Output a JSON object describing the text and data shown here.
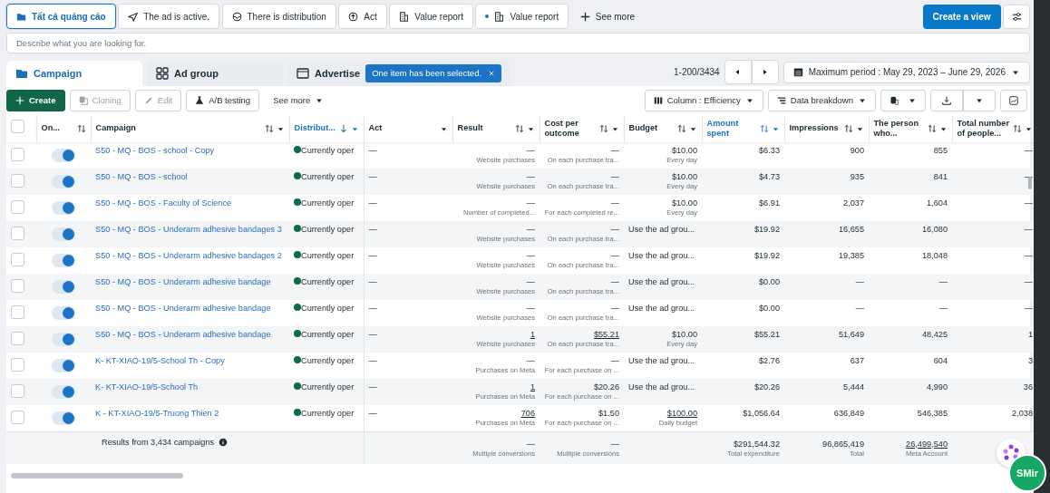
{
  "filters": [
    {
      "label": "Tất cả quảng cáo",
      "selected": true
    },
    {
      "label": "The ad is active.",
      "selected": false
    },
    {
      "label": "There is distribution",
      "selected": false
    },
    {
      "label": "Act",
      "selected": false
    },
    {
      "label": "Value report",
      "selected": false
    },
    {
      "label": "Value report",
      "selected": false,
      "dot": true
    }
  ],
  "filters_more": "See more",
  "create_view": "Create a view",
  "search": {
    "placeholder": "Describe what you are looking for."
  },
  "level_tabs": [
    {
      "label": "Campaign",
      "selected": true
    },
    {
      "label": "Ad group",
      "selected": false
    },
    {
      "label": "Advertise",
      "selected": false
    }
  ],
  "selection_badge": "One item has been selected.",
  "pagination": "1-200/3434",
  "date_range": "Maximum period : May 29, 2023 – June 29, 2026",
  "toolbar": [
    {
      "label": "Create",
      "kind": "primary",
      "disabled": false
    },
    {
      "label": "Cloning",
      "kind": "copy",
      "disabled": true
    },
    {
      "label": "Edit",
      "kind": "edit",
      "disabled": true
    },
    {
      "label": "A/B testing",
      "kind": "flask",
      "disabled": false
    },
    {
      "label": "See more",
      "kind": "menu",
      "disabled": false
    }
  ],
  "view_controls": [
    {
      "label": "Column : Efficiency"
    },
    {
      "label": "Data breakdown"
    }
  ],
  "table": {
    "select_all": {
      "checked": false
    },
    "columns": [
      {
        "label": "On...",
        "sortable": true,
        "menu": false,
        "highlighted": false
      },
      {
        "label": "Campaign",
        "sortable": true,
        "menu": true,
        "highlighted": false
      },
      {
        "label": "Distribut...",
        "sortable": false,
        "sorted_down": true,
        "menu": true,
        "highlighted": true
      },
      {
        "label": "Act",
        "sortable": false,
        "menu": true,
        "highlighted": false
      },
      {
        "label": "Result",
        "sortable": true,
        "menu": true,
        "highlighted": false
      },
      {
        "label": "Cost per outcome",
        "sortable": true,
        "menu": true,
        "highlighted": false
      },
      {
        "label": "Budget",
        "sortable": true,
        "menu": true,
        "highlighted": false
      },
      {
        "label": "Amount spent",
        "sortable": true,
        "menu": true,
        "highlighted": true
      },
      {
        "label": "Impressions",
        "sortable": true,
        "menu": true,
        "highlighted": false
      },
      {
        "label": "The person who...",
        "sortable": true,
        "menu": true,
        "highlighted": false
      },
      {
        "label": "Total number of people...",
        "sortable": true,
        "menu": true,
        "highlighted": false
      }
    ],
    "rows": [
      {
        "checked": false,
        "on": true,
        "name": "S50 - MQ - BOS - school - Copy",
        "status": "Currently oper",
        "act": "—",
        "result": {
          "value": "—",
          "note": "Website purchases"
        },
        "cost": {
          "value": "—",
          "note": "On each purchase tra..."
        },
        "budget": {
          "value": "$10.00",
          "note": "Every day"
        },
        "spent": "$6.33",
        "impressions": "900",
        "reach": "855",
        "total": "—"
      },
      {
        "checked": false,
        "on": true,
        "name": "S50 - MQ - BOS - school",
        "status": "Currently oper",
        "act": "—",
        "result": {
          "value": "—",
          "note": "Website purchases"
        },
        "cost": {
          "value": "—",
          "note": "On each purchase tra..."
        },
        "budget": {
          "value": "$10.00",
          "note": "Every day"
        },
        "spent": "$4.73",
        "impressions": "935",
        "reach": "841",
        "total": "—"
      },
      {
        "checked": false,
        "on": true,
        "name": "S50 - MQ - BOS - Faculty of Science",
        "status": "Currently oper",
        "act": "—",
        "result": {
          "value": "—",
          "note": "Number of completed..."
        },
        "cost": {
          "value": "—",
          "note": "For each completed re..."
        },
        "budget": {
          "value": "$10.00",
          "note": "Every day"
        },
        "spent": "$6.91",
        "impressions": "2,037",
        "reach": "1,604",
        "total": "—"
      },
      {
        "checked": false,
        "on": true,
        "name": "S50 - MQ - BOS - Underarm adhesive bandages 3",
        "status": "Currently oper",
        "act": "—",
        "result": {
          "value": "—",
          "note": "Website purchases"
        },
        "cost": {
          "value": "—",
          "note": "On each purchase tra..."
        },
        "budget": {
          "value": "Use the ad grou..."
        },
        "spent": "$19.92",
        "impressions": "16,655",
        "reach": "16,080",
        "total": "—"
      },
      {
        "checked": false,
        "on": true,
        "name": "S50 - MQ - BOS - Underarm adhesive bandages 2",
        "status": "Currently oper",
        "act": "—",
        "result": {
          "value": "—",
          "note": "Website purchases"
        },
        "cost": {
          "value": "—",
          "note": "On each purchase tra..."
        },
        "budget": {
          "value": "Use the ad grou..."
        },
        "spent": "$19.92",
        "impressions": "19,385",
        "reach": "18,048",
        "total": "—"
      },
      {
        "checked": false,
        "on": true,
        "name": "S50 - MQ - BOS - Underarm adhesive bandage",
        "status": "Currently oper",
        "act": "—",
        "result": {
          "value": "—",
          "note": "Website purchases"
        },
        "cost": {
          "value": "—",
          "note": "On each purchase tra..."
        },
        "budget": {
          "value": "Use the ad grou..."
        },
        "spent": "$0.00",
        "impressions": "—",
        "reach": "—",
        "total": "—"
      },
      {
        "checked": false,
        "on": true,
        "name": "S50 - MQ - BOS - Underarm adhesive bandage",
        "status": "Currently oper",
        "act": "—",
        "result": {
          "value": "—",
          "note": "Website purchases"
        },
        "cost": {
          "value": "—",
          "note": "On each purchase tra..."
        },
        "budget": {
          "value": "Use the ad grou..."
        },
        "spent": "$0.00",
        "impressions": "—",
        "reach": "—",
        "total": "—"
      },
      {
        "checked": false,
        "on": true,
        "name": "S50 - MQ - BOS - Underarm adhesive bandage",
        "status": "Currently oper",
        "act": "—",
        "result": {
          "value": "1",
          "note": "Website purchases",
          "underlined": true
        },
        "cost": {
          "value": "$55.21",
          "note": "On each purchase tra...",
          "underlined": true
        },
        "budget": {
          "value": "$10.00",
          "note": "Every day"
        },
        "spent": "$55.21",
        "impressions": "51,649",
        "reach": "48,425",
        "total": "1"
      },
      {
        "checked": false,
        "on": true,
        "name": "K- KT-XIAO-19/5-School Th - Copy",
        "status": "Currently oper",
        "act": "—",
        "result": {
          "value": "—",
          "note": "Purchases on Meta"
        },
        "cost": {
          "value": "—",
          "note": "For each purchase on ..."
        },
        "budget": {
          "value": "Use the ad grou..."
        },
        "spent": "$2.76",
        "impressions": "637",
        "reach": "604",
        "total": "3"
      },
      {
        "checked": false,
        "on": true,
        "name": "K- KT-XIAO-19/5-School Th",
        "status": "Currently oper",
        "act": "—",
        "result": {
          "value": "1",
          "note": "Purchases on Meta",
          "underlined": true
        },
        "cost": {
          "value": "$20.26",
          "note": "For each purchase on ..."
        },
        "budget": {
          "value": "Use the ad grou..."
        },
        "spent": "$20.26",
        "impressions": "5,444",
        "reach": "4,990",
        "total": "36"
      },
      {
        "checked": false,
        "on": true,
        "name": "K - KT-XIAO-19/5-Truong Thien 2",
        "status": "Currently oper",
        "act": "—",
        "result": {
          "value": "706",
          "note": "Purchases on Meta",
          "underlined": true
        },
        "cost": {
          "value": "$1.50",
          "note": "For each purchase on ..."
        },
        "budget": {
          "value": "$100.00",
          "note": "Daily budget",
          "underlined": true
        },
        "spent": "$1,056.64",
        "impressions": "636,849",
        "reach": "546,385",
        "total": "2,038"
      }
    ],
    "footer": {
      "label": "Results from 3,434 campaigns",
      "result": {
        "value": "—",
        "note": "Multiple conversions"
      },
      "cost": {
        "value": "—",
        "note": "Multiple conversions"
      },
      "spent": {
        "value": "$291,544.32",
        "note": "Total expenditure"
      },
      "impressions": {
        "value": "96,865,419",
        "note": "Total"
      },
      "reach": {
        "value": "26,499,540",
        "note": "Meta Account",
        "underlined": true
      }
    }
  },
  "assistant_badge": "SMir"
}
